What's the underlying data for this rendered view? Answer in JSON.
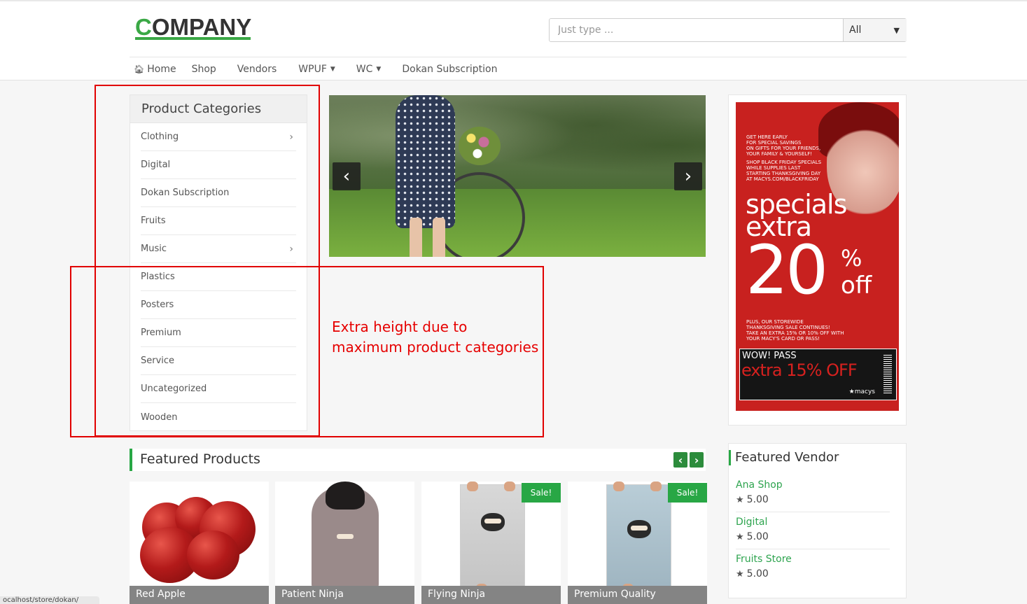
{
  "header": {
    "logo_prefix": "C",
    "logo_rest": "OMPANY",
    "search_placeholder": "Just type ...",
    "search_category": "All"
  },
  "nav": [
    {
      "label": "Home",
      "icon": "home-icon"
    },
    {
      "label": "Shop"
    },
    {
      "label": "Vendors"
    },
    {
      "label": "WPUF",
      "dropdown": true
    },
    {
      "label": "WC",
      "dropdown": true
    },
    {
      "label": "Dokan Subscription"
    }
  ],
  "categories": {
    "title": "Product Categories",
    "items": [
      {
        "label": "Clothing",
        "has_children": true
      },
      {
        "label": "Digital"
      },
      {
        "label": "Dokan Subscription"
      },
      {
        "label": "Fruits"
      },
      {
        "label": "Music",
        "has_children": true
      },
      {
        "label": "Plastics"
      },
      {
        "label": "Posters"
      },
      {
        "label": "Premium"
      },
      {
        "label": "Service"
      },
      {
        "label": "Uncategorized"
      },
      {
        "label": "Wooden"
      }
    ]
  },
  "annotation": {
    "line1": "Extra height due to",
    "line2": "maximum product categories",
    "color": "#e60000"
  },
  "ad": {
    "intro": [
      "GET HERE EARLY",
      "FOR SPECIAL SAVINGS",
      "ON GIFTS FOR YOUR FRIENDS,",
      "YOUR FAMILY & YOURSELF!"
    ],
    "intro2": [
      "SHOP BLACK FRIDAY SPECIALS",
      "WHILE SUPPLIES LAST",
      "STARTING THANKSGIVING DAY",
      "AT MACYS.COM/BLACKFRIDAY"
    ],
    "headline1": "specials",
    "headline2": "extra",
    "big_number": "20",
    "percent": "%",
    "off": "off",
    "sub": [
      "PLUS, OUR STOREWIDE",
      "THANKSGIVING SALE CONTINUES!",
      "TAKE AN EXTRA 15% OR 10% OFF WITH",
      "YOUR MACY'S CARD OR PASS!"
    ],
    "wow": "WOW! PASS",
    "wow_deal": "extra 15% OFF",
    "brand": "★macys"
  },
  "featured_products": {
    "title": "Featured Products",
    "items": [
      {
        "name": "Red Apple",
        "sale": false
      },
      {
        "name": "Patient Ninja",
        "sale": false
      },
      {
        "name": "Flying Ninja",
        "sale": true
      },
      {
        "name": "Premium Quality",
        "sale": true
      }
    ],
    "sale_label": "Sale!"
  },
  "featured_vendor": {
    "title": "Featured Vendor",
    "vendors": [
      {
        "name": "Ana Shop",
        "rating": "5.00"
      },
      {
        "name": "Digital",
        "rating": "5.00"
      },
      {
        "name": "Fruits Store",
        "rating": "5.00"
      }
    ]
  },
  "status_bar": "ocalhost/store/dokan/",
  "colors": {
    "accent": "#28a745",
    "logo_green": "#3aa845",
    "annotation_red": "#e10000"
  }
}
